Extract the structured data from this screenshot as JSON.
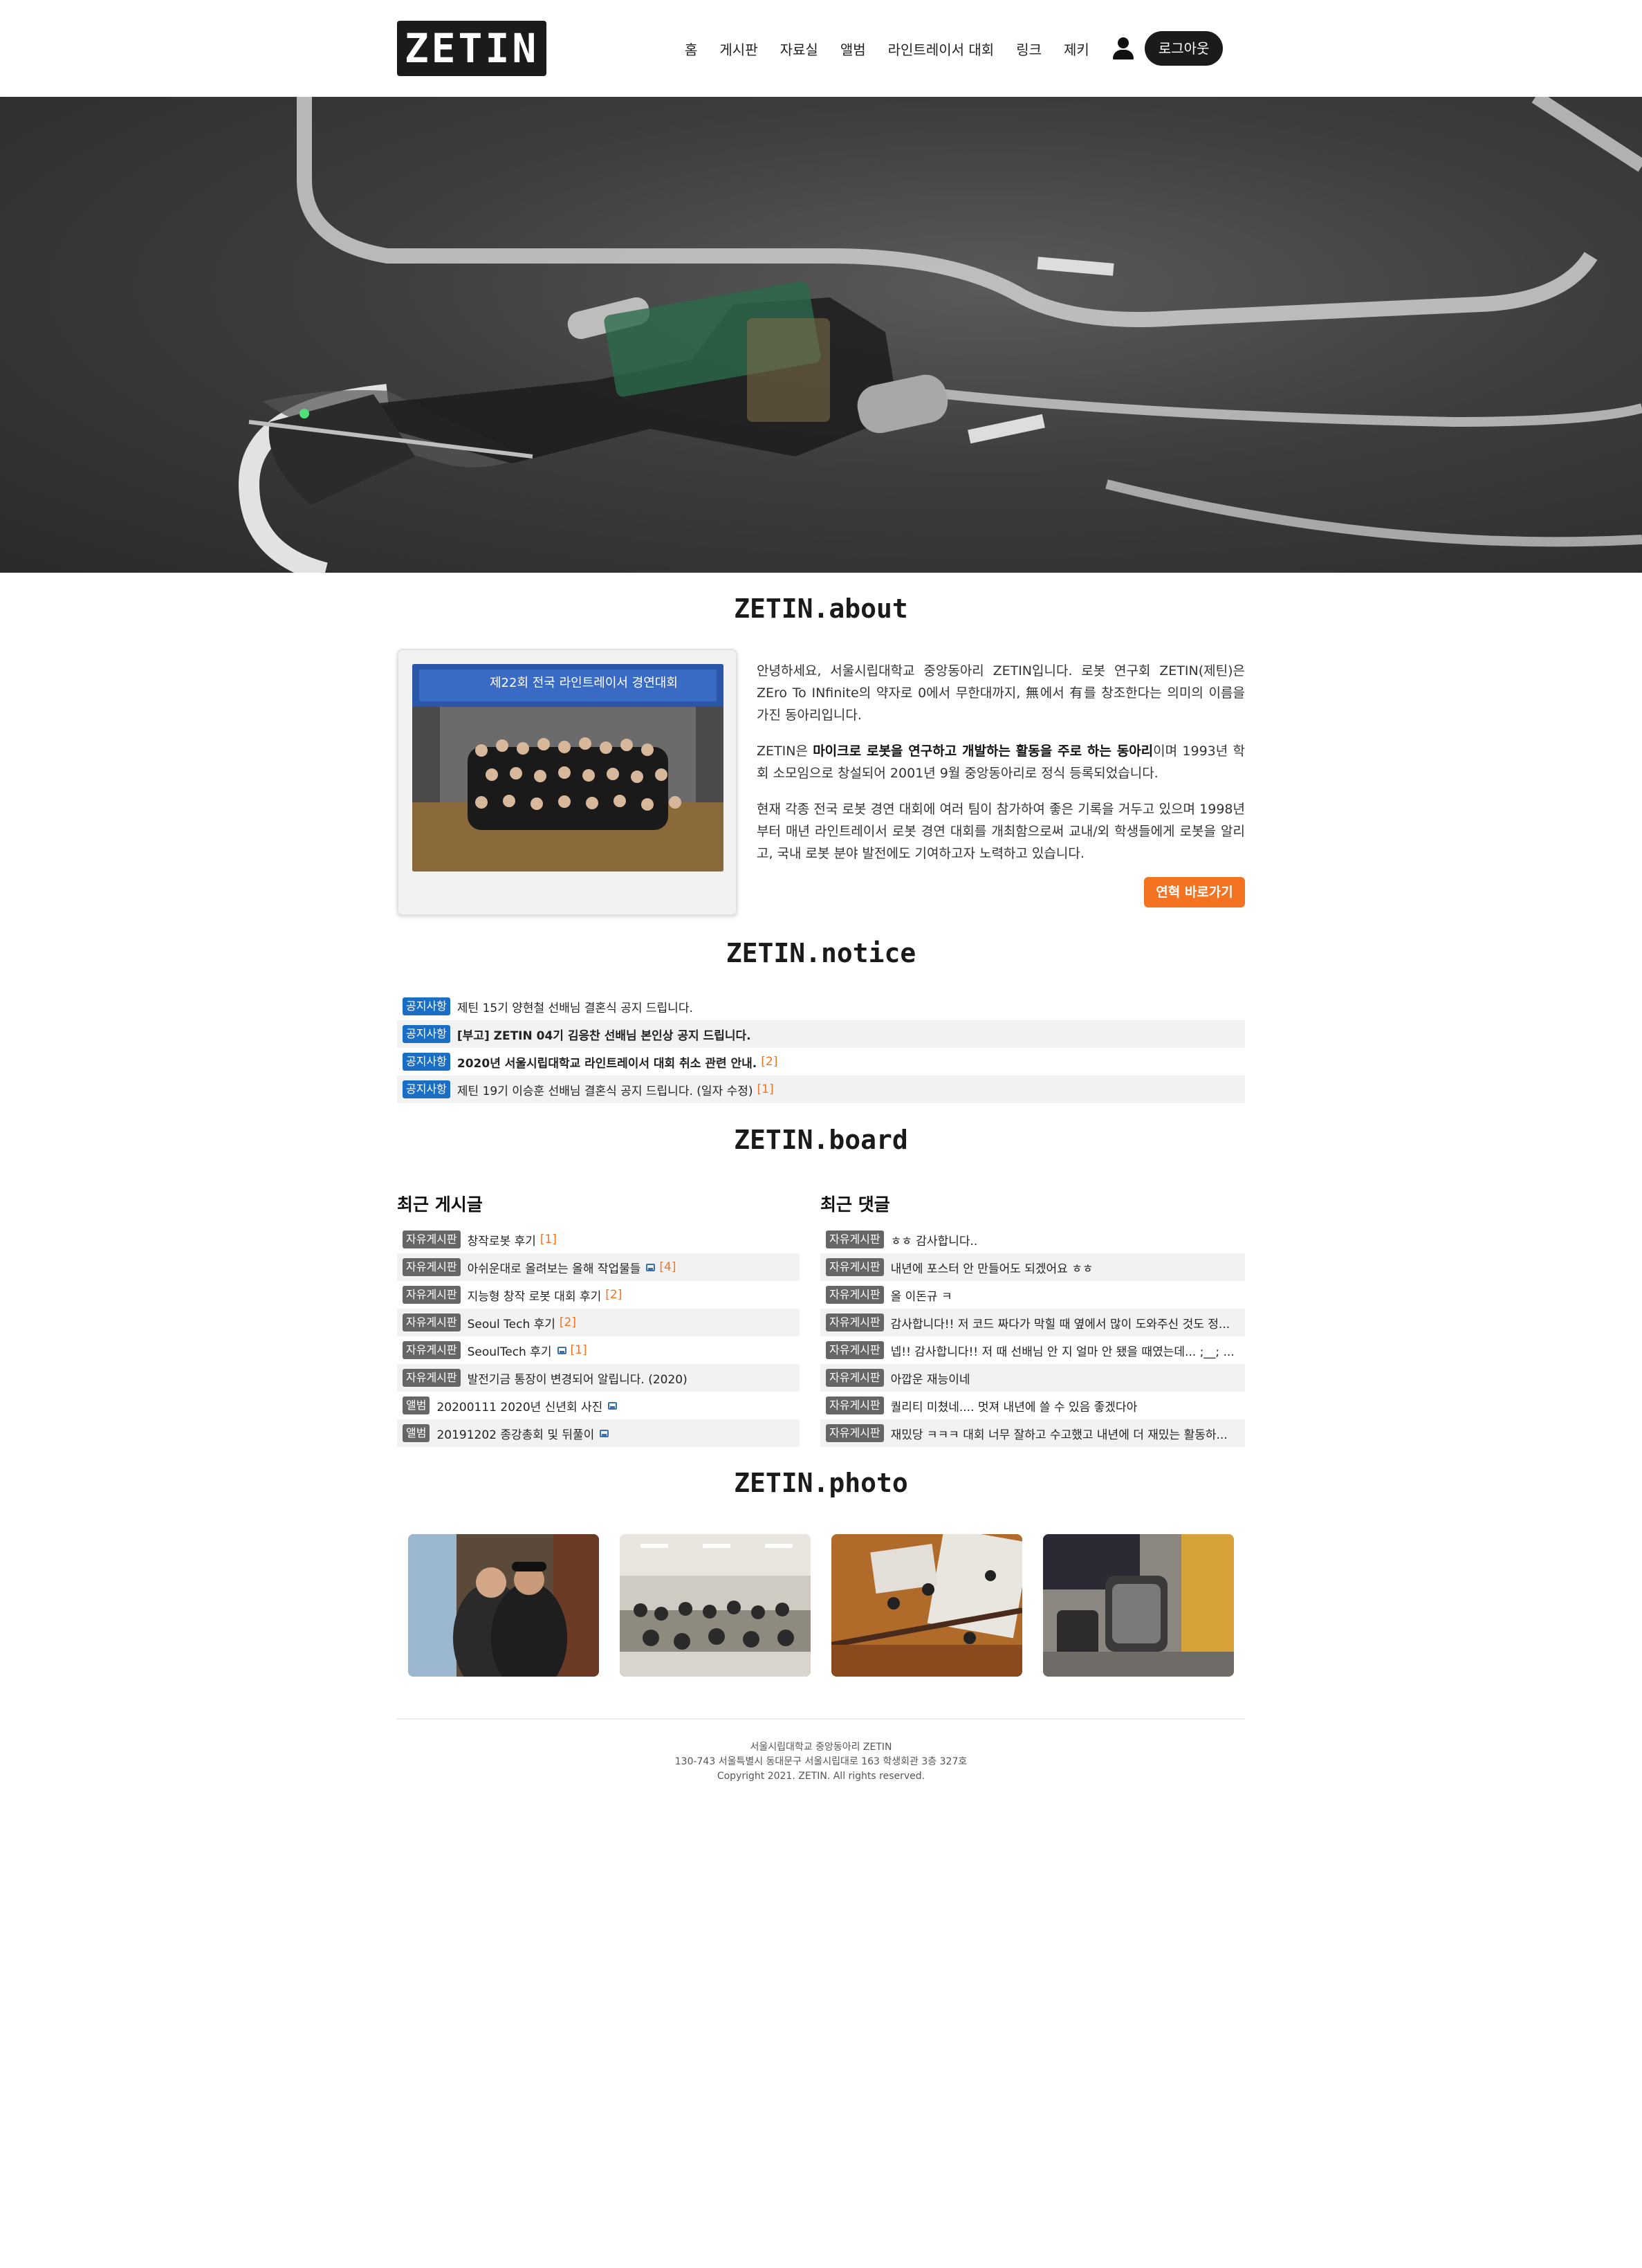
{
  "header": {
    "logo": "ZETIN",
    "nav": [
      "홈",
      "게시판",
      "자료실",
      "앨범",
      "라인트레이서 대회",
      "링크",
      "제키"
    ],
    "logout": "로그아웃"
  },
  "about": {
    "title": "ZETIN.about",
    "paragraph1": "안녕하세요, 서울시립대학교 중앙동아리 ZETIN입니다. 로봇 연구회 ZETIN(제틴)은 ZEro To INfinite의 약자로 0에서 무한대까지, 無에서 有를 창조한다는 의미의 이름을 가진 동아리입니다.",
    "paragraph2_pre": "ZETIN은 ",
    "paragraph2_bold": "마이크로 로봇을 연구하고 개발하는 활동을 주로 하는 동아리",
    "paragraph2_post": "이며 1993년 학회 소모임으로 창설되어 2001년 9월 중앙동아리로 정식 등록되었습니다.",
    "paragraph3": "현재 각종 전국 로봇 경연 대회에 여러 팀이 참가하여 좋은 기록을 거두고 있으며 1998년부터 매년 라인트레이서 로봇 경연 대회를 개최함으로써 교내/외 학생들에게 로봇을 알리고, 국내 로봇 분야 발전에도 기여하고자 노력하고 있습니다.",
    "history_button": "연혁 바로가기",
    "photo_banner": "제22회 전국 라인트레이서 경연대회"
  },
  "notice": {
    "title": "ZETIN.notice",
    "items": [
      {
        "badge": "공지사항",
        "text": "제틴 15기 양현철 선배님 결혼식 공지 드립니다.",
        "count": "",
        "bold": false
      },
      {
        "badge": "공지사항",
        "text": "[부고] ZETIN 04기 김응찬 선배님 본인상 공지 드립니다.",
        "count": "",
        "bold": true
      },
      {
        "badge": "공지사항",
        "text": "2020년 서울시립대학교 라인트레이서 대회 취소 관련 안내.",
        "count": "[2]",
        "bold": true
      },
      {
        "badge": "공지사항",
        "text": "제틴 19기 이승훈 선배님 결혼식 공지 드립니다. (일자 수정)",
        "count": "[1]",
        "bold": false
      }
    ]
  },
  "board": {
    "title": "ZETIN.board",
    "recent_posts_title": "최근 게시글",
    "recent_comments_title": "최근 댓글",
    "posts": [
      {
        "badge": "자유게시판",
        "text": "창작로봇 후기",
        "count": "[1]"
      },
      {
        "badge": "자유게시판",
        "text": "아쉬운대로 올려보는 올해 작업물들",
        "count": "[4]"
      },
      {
        "badge": "자유게시판",
        "text": "지능형 창작 로봇 대회 후기",
        "count": "[2]"
      },
      {
        "badge": "자유게시판",
        "text": "Seoul Tech 후기",
        "count": "[2]"
      },
      {
        "badge": "자유게시판",
        "text": "SeoulTech 후기",
        "count": "[1]"
      },
      {
        "badge": "자유게시판",
        "text": "발전기금 통장이 변경되어 알립니다. (2020)",
        "count": ""
      },
      {
        "badge": "앨범",
        "text": "20200111 2020년 신년회 사진",
        "count": ""
      },
      {
        "badge": "앨범",
        "text": "20191202 종강총회 및 뒤풀이",
        "count": ""
      }
    ],
    "comments": [
      {
        "badge": "자유게시판",
        "text": "ㅎㅎ 감사합니다.."
      },
      {
        "badge": "자유게시판",
        "text": "내년에 포스터 안 만들어도 되겠어요 ㅎㅎ"
      },
      {
        "badge": "자유게시판",
        "text": "올 이돈규 ㅋ"
      },
      {
        "badge": "자유게시판",
        "text": "감사합니다!! 저 코드 짜다가 막힐 때 옆에서 많이 도와주신 것도 정..."
      },
      {
        "badge": "자유게시판",
        "text": "넵!! 감사합니다!! 저 때 선배님 안 지 얼마 안 됐을 때였는데... ;__; ..."
      },
      {
        "badge": "자유게시판",
        "text": "아깝운 재능이네"
      },
      {
        "badge": "자유게시판",
        "text": "퀄리티 미쳤네.... 멋져 내년에 쓸 수 있음 좋겠다아"
      },
      {
        "badge": "자유게시판",
        "text": "재밌당 ㅋㅋㅋ 대회 너무 잘하고 수고했고 내년에 더 재밌는 활동하..."
      }
    ]
  },
  "photo": {
    "title": "ZETIN.photo"
  },
  "footer": {
    "line1": "서울시립대학교 중앙동아리 ZETIN",
    "line2": "130-743 서울특별시 동대문구 서울시립대로 163 학생회관 3층 327호",
    "line3": "Copyright 2021. ZETIN. All rights reserved."
  },
  "colors": {
    "accent": "#f37321",
    "notice_badge": "#1a6fc4",
    "board_badge": "#666666",
    "nav_highlight": "#f7e21a"
  }
}
